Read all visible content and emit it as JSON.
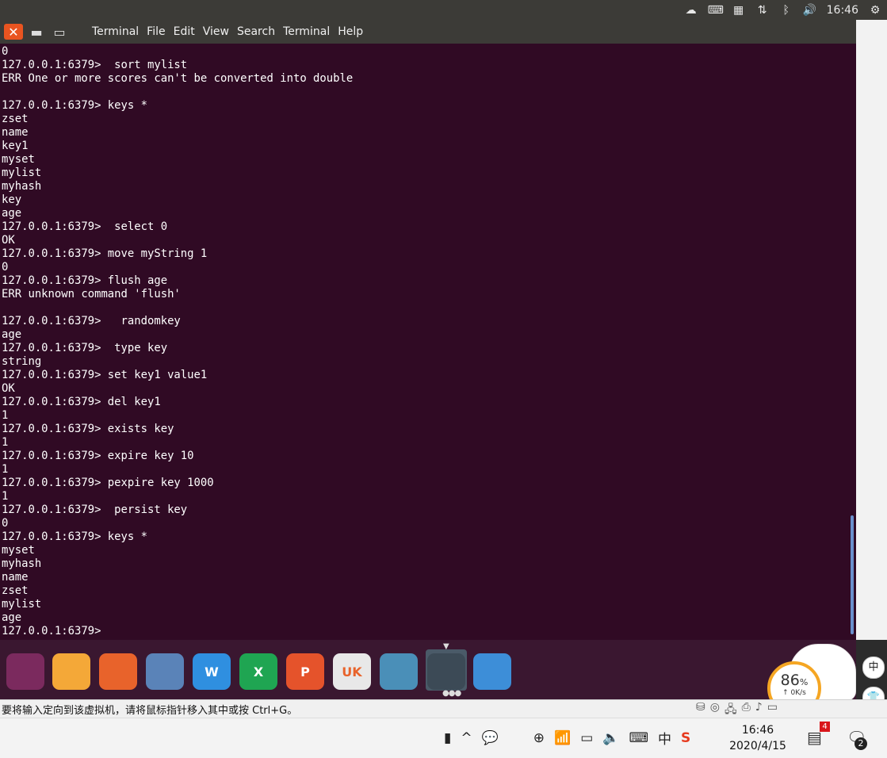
{
  "top_panel": {
    "clock": "16:46",
    "icons": [
      "weather-icon",
      "keyboard-icon",
      "calendar-icon",
      "network-transfer-icon",
      "bluetooth-icon",
      "volume-icon",
      "settings-gear-icon"
    ]
  },
  "window": {
    "menu": [
      "Terminal",
      "File",
      "Edit",
      "View",
      "Search",
      "Terminal",
      "Help"
    ]
  },
  "terminal": {
    "lines": [
      "0",
      "127.0.0.1:6379>  sort mylist",
      "ERR One or more scores can't be converted into double",
      "",
      "127.0.0.1:6379> keys *",
      "zset",
      "name",
      "key1",
      "myset",
      "mylist",
      "myhash",
      "key",
      "age",
      "127.0.0.1:6379>  select 0",
      "OK",
      "127.0.0.1:6379> move myString 1",
      "0",
      "127.0.0.1:6379> flush age",
      "ERR unknown command 'flush'",
      "",
      "127.0.0.1:6379>   randomkey",
      "age",
      "127.0.0.1:6379>  type key",
      "string",
      "127.0.0.1:6379> set key1 value1",
      "OK",
      "127.0.0.1:6379> del key1",
      "1",
      "127.0.0.1:6379> exists key",
      "1",
      "127.0.0.1:6379> expire key 10",
      "1",
      "127.0.0.1:6379> pexpire key 1000",
      "1",
      "127.0.0.1:6379>  persist key",
      "0",
      "127.0.0.1:6379> keys *",
      "myset",
      "myhash",
      "name",
      "zset",
      "mylist",
      "age",
      "127.0.0.1:6379> "
    ]
  },
  "dock": {
    "apps": [
      {
        "name": "ubuntu-logo-icon",
        "label": "",
        "color": "#7b2a5e"
      },
      {
        "name": "files-folder-icon",
        "label": "",
        "color": "#f4a838"
      },
      {
        "name": "firefox-icon",
        "label": "",
        "color": "#e8632b"
      },
      {
        "name": "chromium-icon",
        "label": "",
        "color": "#5a83b8"
      },
      {
        "name": "wps-writer-icon",
        "label": "W",
        "color": "#2f8fe0"
      },
      {
        "name": "wps-spreadsheet-icon",
        "label": "X",
        "color": "#1fa552"
      },
      {
        "name": "wps-presentation-icon",
        "label": "P",
        "color": "#e5532b"
      },
      {
        "name": "uk-software-center-icon",
        "label": "UK",
        "color": "#e8e8e8"
      },
      {
        "name": "system-cleaner-icon",
        "label": "",
        "color": "#4a8fb8"
      },
      {
        "name": "terminal-icon",
        "label": "",
        "color": "#3c4a56"
      },
      {
        "name": "workspace-switcher-icon",
        "label": "",
        "color": "#3d8ed8"
      }
    ]
  },
  "vm_status": {
    "message": "要将输入定向到该虚拟机，请将鼠标指针移入其中或按 Ctrl+G。"
  },
  "net_widget": {
    "percent": "86",
    "percent_unit": "%",
    "speed": "↑ 0K/s"
  },
  "side_buttons": {
    "ime": "中",
    "shirt": "👕"
  },
  "taskbar": {
    "ime": "中",
    "time": "16:46",
    "date": "2020/4/15",
    "notification_count": "4",
    "action_center_count": "2"
  }
}
